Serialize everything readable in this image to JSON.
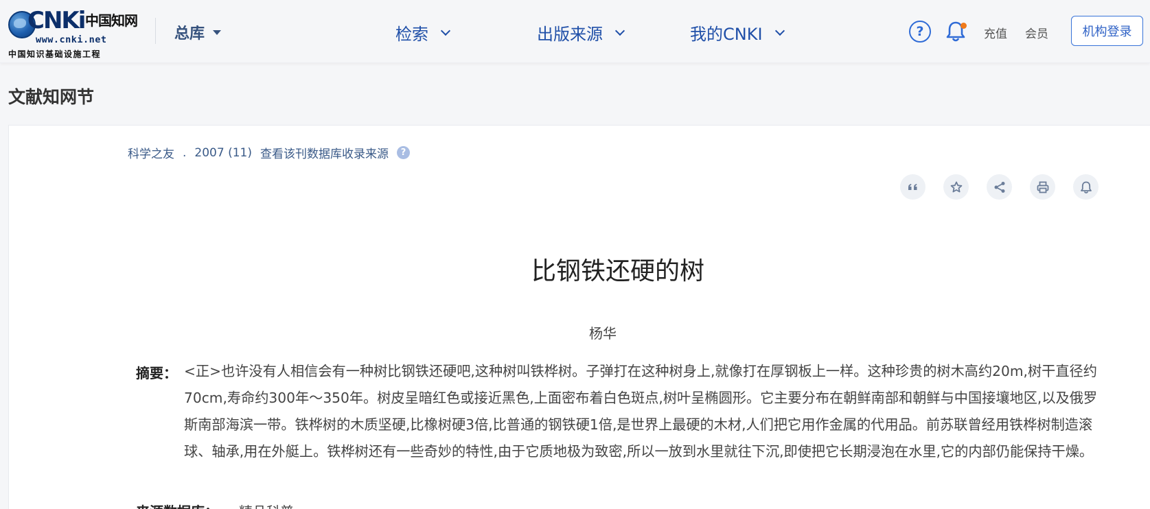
{
  "header": {
    "logo": {
      "brand": "CNKi",
      "brand_cn": "中国知网",
      "url": "www.cnki.net",
      "subtitle": "中国知识基础设施工程"
    },
    "library_select": "总库",
    "nav": [
      {
        "label": "检索"
      },
      {
        "label": "出版来源"
      },
      {
        "label": "我的CNKI"
      }
    ],
    "help_icon": "?",
    "recharge": "充值",
    "member": "会员",
    "login": "机构登录",
    "accent_color": "#1f4fa8",
    "notification_dot_color": "#f07a1a"
  },
  "section_title": "文献知网节",
  "article": {
    "source": {
      "journal": "科学之友",
      "separator": ".",
      "issue": "2007 (11)",
      "link": "查看该刊数据库收录来源",
      "help_icon": "?"
    },
    "tools": [
      "quote-icon",
      "star-icon",
      "share-icon",
      "print-icon",
      "bell-icon"
    ],
    "title": "比钢铁还硬的树",
    "author": "杨华",
    "abstract_label": "摘要：",
    "abstract": "<正>也许没有人相信会有一种树比钢铁还硬吧,这种树叫铁桦树。子弹打在这种树身上,就像打在厚钢板上一样。这种珍贵的树木高约20m,树干直径约70cm,寿命约300年～350年。树皮呈暗红色或接近黑色,上面密布着白色斑点,树叶呈椭圆形。它主要分布在朝鲜南部和朝鲜与中国接壤地区,以及俄罗斯南部海滨一带。铁桦树的木质坚硬,比橡树硬3倍,比普通的钢铁硬1倍,是世界上最硬的木材,人们把它用作金属的代用品。前苏联曾经用铁桦树制造滚球、轴承,用在外艇上。铁桦树还有一些奇妙的特性,由于它质地极为致密,所以一放到水里就往下沉,即使把它长期浸泡在水里,它的内部仍能保持干燥。",
    "source_db_label": "来源数据库：",
    "source_db_value": "精品科普"
  }
}
